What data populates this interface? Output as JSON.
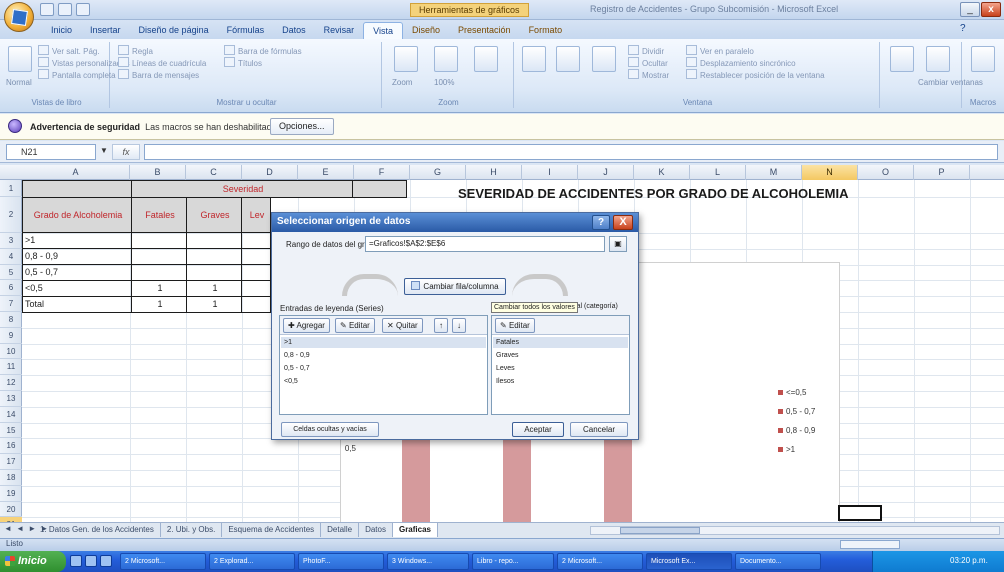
{
  "window": {
    "context_tab_title": "Herramientas de gráficos",
    "title": "Registro de Accidentes - Grupo Subcomisión - Microsoft Excel",
    "minimize": "_",
    "close": "x"
  },
  "ribbon": {
    "tabs": [
      "Inicio",
      "Insertar",
      "Diseño de página",
      "Fórmulas",
      "Datos",
      "Revisar",
      "Vista",
      "Diseño",
      "Presentación",
      "Formato"
    ],
    "active_tab": "Vista",
    "groups": {
      "views": "Vistas de libro",
      "show": "Mostrar u ocultar",
      "zoom": "Zoom",
      "window": "Ventana",
      "macros": "Macros"
    },
    "items": {
      "normal": "Normal",
      "page_layout": "Diseño de página",
      "page_break": "Ver salt. Pág.",
      "custom_views": "Vistas personalizadas",
      "full_screen": "Pantalla completa",
      "ruler": "Regla",
      "gridlines": "Líneas de cuadrícula",
      "message_bar": "Barra de mensajes",
      "formula_bar": "Barra de fórmulas",
      "headings": "Títulos",
      "zoom": "Zoom",
      "zoom100": "100%",
      "zoom_sel": "Ampliar selección",
      "new_window": "Nueva ventana",
      "arrange": "Organizar todo",
      "freeze": "Inmovilizar",
      "split": "Dividir",
      "hide": "Ocultar",
      "unhide": "Mostrar",
      "side_by_side": "Ver en paralelo",
      "sync_scroll": "Desplazamiento sincrónico",
      "reset_pos": "Restablecer posición de la ventana",
      "save_ws": "Guardar área de trabajo",
      "switch": "Cambiar ventanas",
      "macros": "Macros"
    }
  },
  "security": {
    "label": "Advertencia de seguridad",
    "message": "Las macros se han deshabilitado.",
    "options": "Opciones..."
  },
  "formula_bar": {
    "name_box": "N21",
    "fx": "fx",
    "value": ""
  },
  "grid": {
    "columns": [
      "A",
      "B",
      "C",
      "D",
      "E",
      "F",
      "G",
      "H",
      "I",
      "J",
      "K",
      "L",
      "M",
      "N",
      "O",
      "P"
    ],
    "rows": [
      "1",
      "2",
      "3",
      "4",
      "5",
      "6",
      "7",
      "8",
      "9",
      "10",
      "11",
      "12",
      "13",
      "14",
      "15",
      "16",
      "17",
      "18",
      "19",
      "20",
      "21"
    ],
    "selected_column": "N",
    "selected_row": "21"
  },
  "table": {
    "severity_header": "Severidad",
    "col_grado": "Grado de Alcoholemia",
    "col_fatales": "Fatales",
    "col_graves": "Graves",
    "col_leves": "Lev",
    "rows": [
      {
        "label": ">1",
        "fatales": "",
        "graves": ""
      },
      {
        "label": "0,8 - 0,9",
        "fatales": "",
        "graves": ""
      },
      {
        "label": "0,5 - 0,7",
        "fatales": "",
        "graves": ""
      },
      {
        "label": "<0,5",
        "fatales": "1",
        "graves": "1"
      },
      {
        "label": "Total",
        "fatales": "1",
        "graves": "1"
      }
    ]
  },
  "chart": {
    "title": "SEVERIDAD DE ACCIDENTES POR GRADO DE ALCOHOLEMIA",
    "legend": [
      "<=0,5",
      "0,5 - 0,7",
      "0,8 - 0,9",
      ">1"
    ],
    "legend_colors": [
      "#c0504d",
      "#c0504d",
      "#c0504d",
      "#c0504d"
    ]
  },
  "chart_data": {
    "type": "bar",
    "title": "SEVERIDAD DE ACCIDENTES POR GRADO DE ALCOHOLEMIA",
    "y_ticks": [
      "1",
      "0,5"
    ],
    "legend_entries": [
      "<=0,5",
      "0,5 - 0,7",
      "0,8 - 0,9",
      ">1"
    ],
    "ylim": [
      0,
      1.5
    ],
    "values": [
      1,
      1,
      1
    ],
    "bar_color": "#d59a9c"
  },
  "dialog": {
    "title": "Seleccionar origen de datos",
    "help": "?",
    "close": "X",
    "range_label": "Rango de datos del gráfico:",
    "range_value": "=Graficos!$A$2:$E$6",
    "switch_label": "Cambiar fila/columna",
    "legend_label": "Entradas de leyenda (Series)",
    "axis_label": "Etiquetas del eje horizontal (categoría)",
    "tooltip": "Cambiar todos los valores",
    "add": "Agregar",
    "edit": "Editar",
    "remove": "Quitar",
    "up": "↑",
    "down": "↓",
    "edit_axis": "Editar",
    "series": [
      ">1",
      "0,8 - 0,9",
      "0,5 - 0,7",
      "<0,5"
    ],
    "categories": [
      "Fatales",
      "Graves",
      "Leves",
      "Ilesos"
    ],
    "hidden_button": "Celdas ocultas y vacías",
    "ok": "Aceptar",
    "cancel": "Cancelar"
  },
  "sheets": {
    "nav": "◄ ◄ ► ►",
    "tabs": [
      "1. Datos Gen. de los Accidentes",
      "2. Ubi. y Obs.",
      "Esquema de Accidentes",
      "Detalle",
      "Datos",
      "Graficas"
    ],
    "active": "Graficas"
  },
  "status": {
    "text": "Listo"
  },
  "taskbar": {
    "start": "Inicio",
    "tasks": [
      "2 Microsoft...",
      "2 Explorad...",
      "PhotoF...",
      "3 Windows...",
      "Libro - repo...",
      "2 Microsoft...",
      "Microsoft Ex...",
      "Documento..."
    ],
    "clock": "03:20 p.m."
  }
}
